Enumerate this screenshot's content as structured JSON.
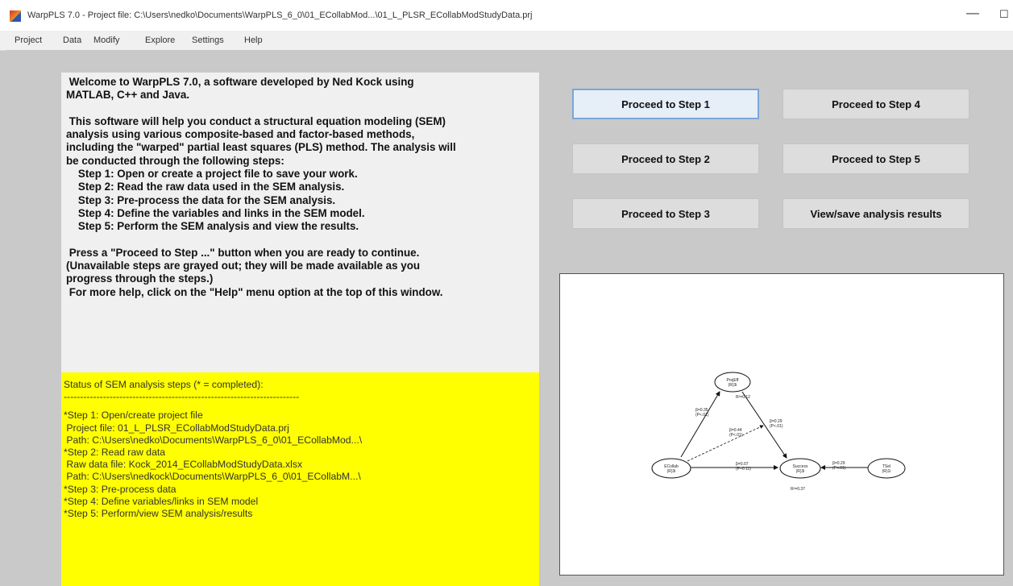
{
  "window": {
    "title": "WarpPLS 7.0 - Project file: C:\\Users\\nedko\\Documents\\WarpPLS_6_0\\01_ECollabMod...\\01_L_PLSR_ECollabModStudyData.prj",
    "minimize": "—",
    "maximize": "☐"
  },
  "menu": [
    "Project",
    "Data",
    "Modify",
    "Explore",
    "Settings",
    "Help"
  ],
  "welcome_text": " Welcome to WarpPLS 7.0, a software developed by Ned Kock using\nMATLAB, C++ and Java.\n\n This software will help you conduct a structural equation modeling (SEM)\nanalysis using various composite-based and factor-based methods,\nincluding the \"warped\" partial least squares (PLS) method. The analysis will\nbe conducted through the following steps:\n    Step 1: Open or create a project file to save your work.\n    Step 2: Read the raw data used in the SEM analysis.\n    Step 3: Pre-process the data for the SEM analysis.\n    Step 4: Define the variables and links in the SEM model.\n    Step 5: Perform the SEM analysis and view the results.\n\n Press a \"Proceed to Step ...\" button when you are ready to continue.\n(Unavailable steps are grayed out; they will be made available as you\nprogress through the steps.)\n For more help, click on the \"Help\" menu option at the top of this window.",
  "status": {
    "lines": [
      "Status of SEM analysis steps (* = completed):",
      "------------------------------------------------------------------------",
      "",
      "*Step 1: Open/create project file",
      " Project file: 01_L_PLSR_ECollabModStudyData.prj",
      " Path: C:\\Users\\nedko\\Documents\\WarpPLS_6_0\\01_ECollabMod...\\",
      "*Step 2: Read raw data",
      " Raw data file: Kock_2014_ECollabModStudyData.xlsx",
      " Path: C:\\Users\\nedkock\\Documents\\WarpPLS_6_0\\01_ECollabM...\\",
      "*Step 3: Pre-process data",
      "*Step 4: Define variables/links in SEM model",
      "*Step 5: Perform/view SEM analysis/results"
    ]
  },
  "buttons": {
    "step1": "Proceed to Step 1",
    "step2": "Proceed to Step 2",
    "step3": "Proceed to Step 3",
    "step4": "Proceed to Step 4",
    "step5": "Proceed to Step 5",
    "results": "View/save analysis results"
  },
  "model": {
    "ecollab": {
      "name": "ECollab",
      "type": "(R)3i"
    },
    "projeff": {
      "name": "ProjEff",
      "type": "(R)3i"
    },
    "success": {
      "name": "Success",
      "type": "(R)3i"
    },
    "tsel": {
      "name": "TSel",
      "type": "(R)1i"
    },
    "r2_projeff": "R²=0.12",
    "r2_success": "R²=0.37",
    "path_ecollab_projeff": {
      "beta": "β=0.35",
      "p": "(P<.01)"
    },
    "path_projeff_success": {
      "beta": "β=0.29",
      "p": "(P<.01)"
    },
    "path_ecollab_success": {
      "beta": "β=0.07",
      "p": "(P=0.11)"
    },
    "path_moderation": {
      "beta": "β=0.44",
      "p": "(P<.01)"
    },
    "path_tsel_success": {
      "beta": "β=0.29",
      "p": "(P<.01)"
    }
  },
  "colors": {
    "status_bg": "#ffff00",
    "panel_bg": "#c9c9c9",
    "text_bg": "#f0f0f0"
  }
}
